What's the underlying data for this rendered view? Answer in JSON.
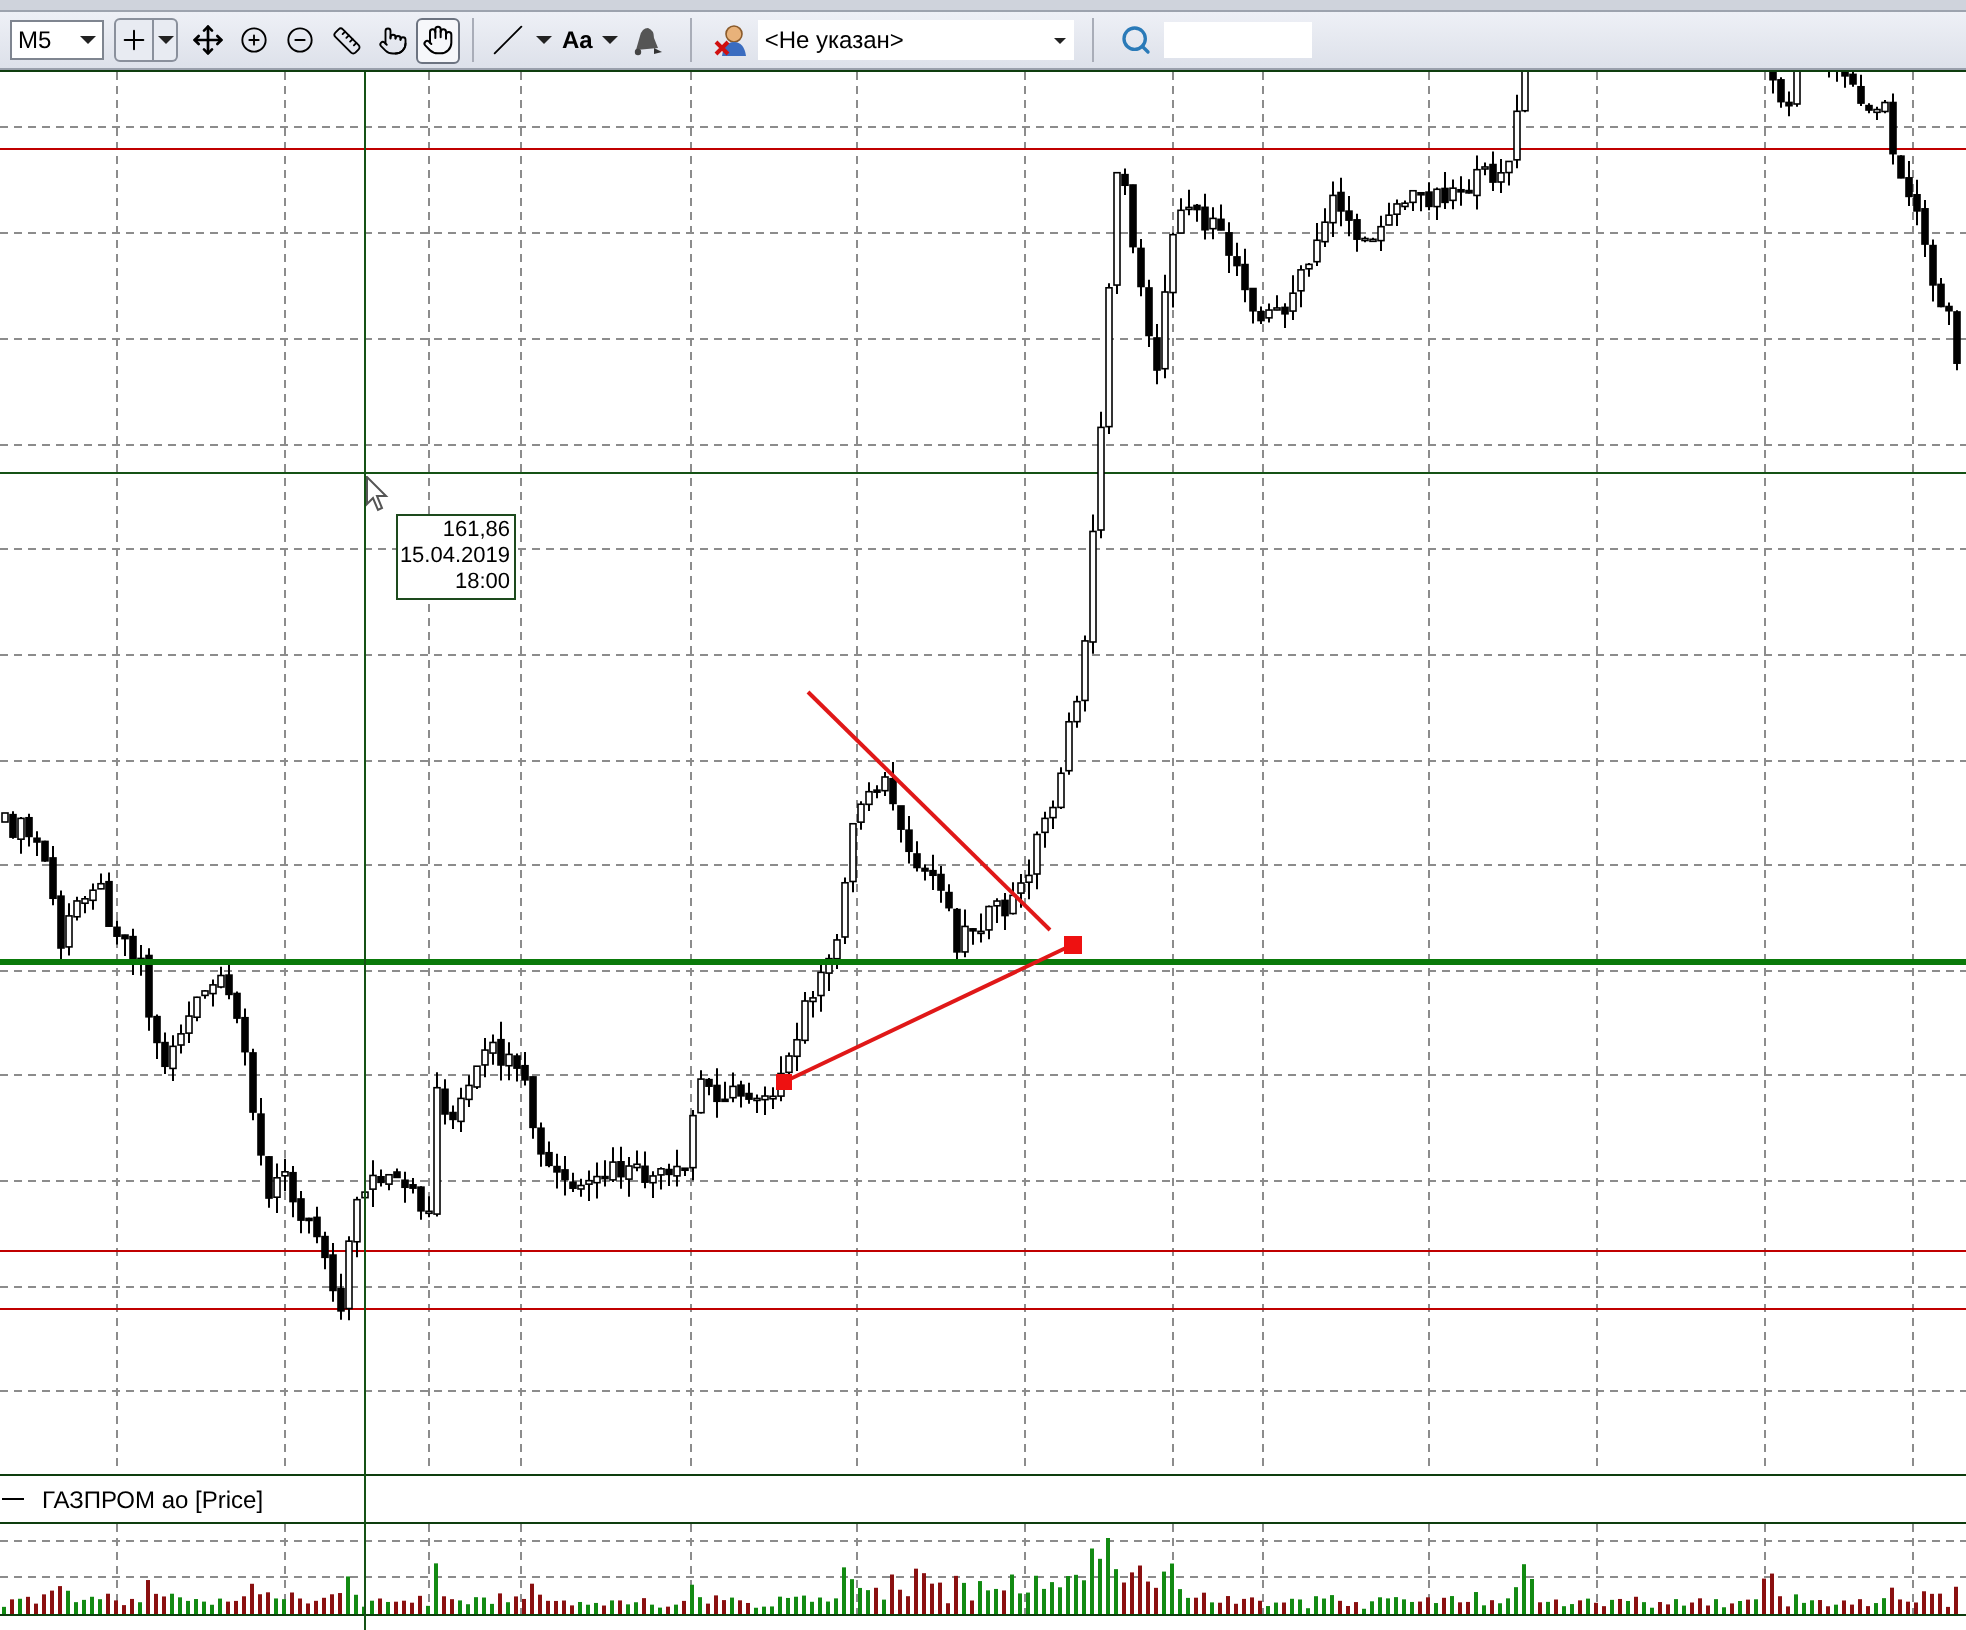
{
  "toolbar": {
    "timeframe": {
      "value": "M5"
    },
    "tools": [
      {
        "kind": "crosshair",
        "selected": false
      },
      {
        "kind": "move",
        "selected": false
      },
      {
        "kind": "zoom_in",
        "selected": false
      },
      {
        "kind": "zoom_out",
        "selected": false
      },
      {
        "kind": "ruler",
        "selected": false
      },
      {
        "kind": "pointer_hand",
        "selected": false
      },
      {
        "kind": "hand",
        "selected": true
      }
    ],
    "drawing_tools": [
      {
        "kind": "line",
        "dropdown": true
      },
      {
        "kind": "text",
        "label": "Aa",
        "dropdown": true
      },
      {
        "kind": "alert",
        "dropdown": false
      }
    ],
    "account": {
      "value": "<Не указан>"
    }
  },
  "chart": {
    "cursor_tooltip": {
      "price": "161,86",
      "date": "15.04.2019",
      "time": "18:00"
    },
    "legend": {
      "label": "ГАЗПРОМ ао [Price]"
    }
  }
}
